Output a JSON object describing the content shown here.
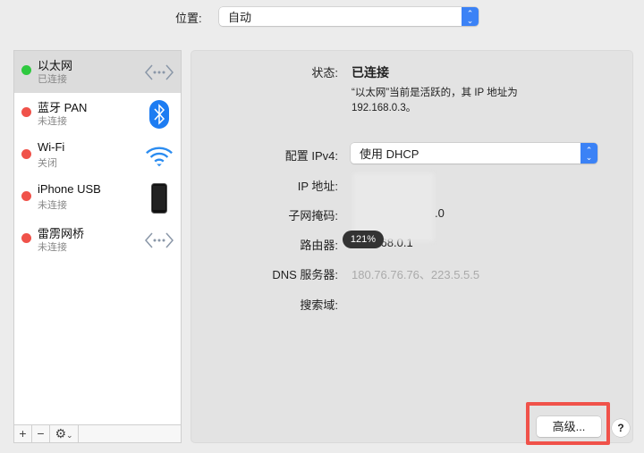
{
  "location": {
    "label": "位置:",
    "value": "自动"
  },
  "services": [
    {
      "name": "以太网",
      "status": "已连接",
      "dot": "#2ec93f",
      "icon": "ethernet-icon",
      "selected": true
    },
    {
      "name": "蓝牙 PAN",
      "status": "未连接",
      "dot": "#f0524a",
      "icon": "bluetooth-icon"
    },
    {
      "name": "Wi-Fi",
      "status": "关闭",
      "dot": "#f0524a",
      "icon": "wifi-icon"
    },
    {
      "name": "iPhone USB",
      "status": "未连接",
      "dot": "#f0524a",
      "icon": "iphone-icon"
    },
    {
      "name": "雷雳网桥",
      "status": "未连接",
      "dot": "#f0524a",
      "icon": "thunderbolt-bridge-icon"
    }
  ],
  "toolbar": {
    "add": "+",
    "remove": "−",
    "gear": "⚙"
  },
  "detail": {
    "status_label": "状态:",
    "status_value": "已连接",
    "status_desc": "“以太网”当前是活跃的，其 IP 地址为192.168.0.3。",
    "config_label": "配置 IPv4:",
    "config_value": "使用 DHCP",
    "ip_label": "IP 地址:",
    "subnet_label": "子网掩码:",
    "subnet_tail": ".0",
    "router_label": "路由器:",
    "router_value": "192.168.0.1",
    "dns_label": "DNS 服务器:",
    "dns_value": "180.76.76.76、223.5.5.5",
    "search_label": "搜索域:"
  },
  "zoom_badge": "121%",
  "advanced_button": "高级...",
  "help_button": "?"
}
